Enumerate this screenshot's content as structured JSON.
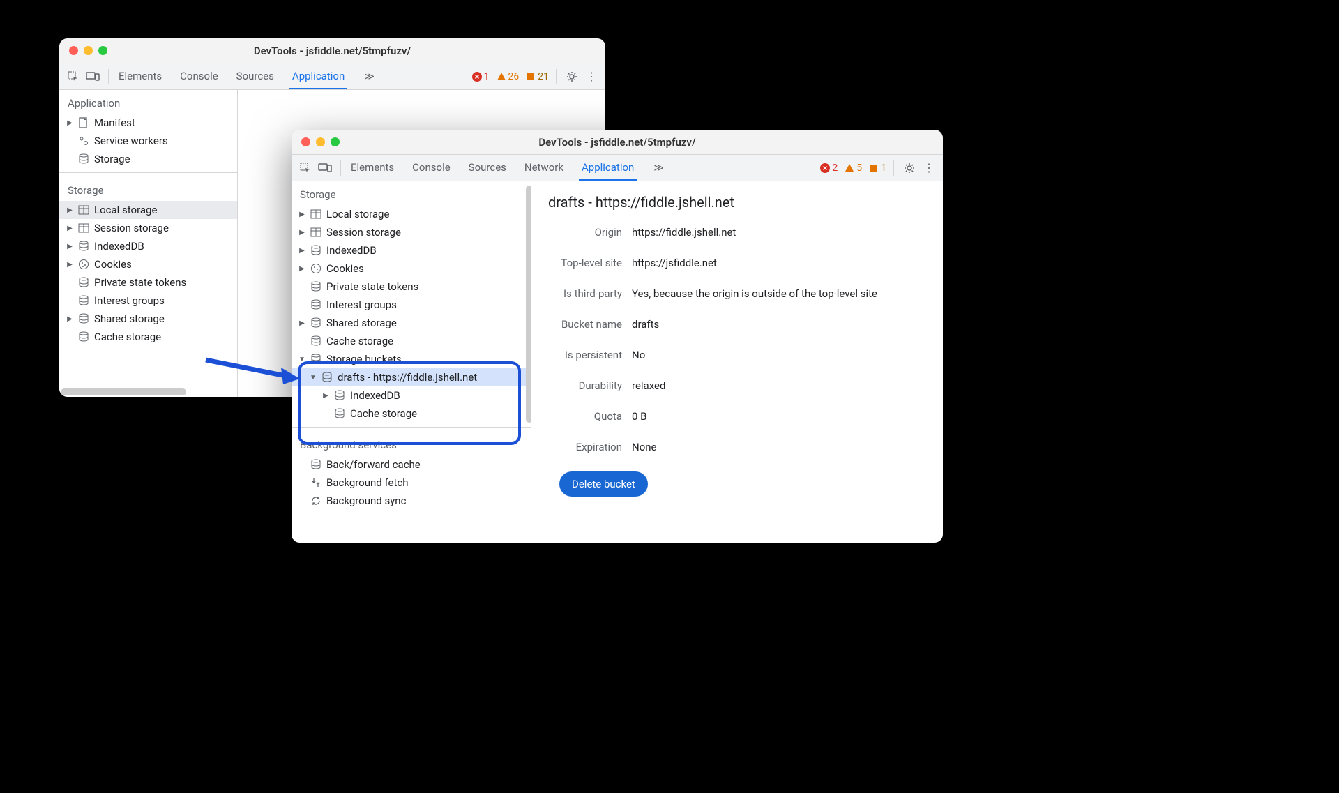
{
  "windowA": {
    "title": "DevTools - jsfiddle.net/5tmpfuzv/",
    "tabs": [
      "Elements",
      "Console",
      "Sources",
      "Application"
    ],
    "active_tab": "Application",
    "badges": {
      "errors": "1",
      "warnings": "26",
      "issues": "21"
    },
    "sections": {
      "application": {
        "heading": "Application",
        "items": [
          "Manifest",
          "Service workers",
          "Storage"
        ]
      },
      "storage": {
        "heading": "Storage",
        "items": [
          "Local storage",
          "Session storage",
          "IndexedDB",
          "Cookies",
          "Private state tokens",
          "Interest groups",
          "Shared storage",
          "Cache storage"
        ]
      }
    }
  },
  "windowB": {
    "title": "DevTools - jsfiddle.net/5tmpfuzv/",
    "tabs": [
      "Elements",
      "Console",
      "Sources",
      "Network",
      "Application"
    ],
    "active_tab": "Application",
    "badges": {
      "errors": "2",
      "warnings": "5",
      "issues": "1"
    },
    "sidebar": {
      "storage_heading": "Storage",
      "storage_items": [
        "Local storage",
        "Session storage",
        "IndexedDB",
        "Cookies",
        "Private state tokens",
        "Interest groups",
        "Shared storage",
        "Cache storage",
        "Storage buckets"
      ],
      "bucket_item": "drafts - https://fiddle.jshell.net",
      "bucket_children": [
        "IndexedDB",
        "Cache storage"
      ],
      "bg_heading": "Background services",
      "bg_items": [
        "Back/forward cache",
        "Background fetch",
        "Background sync"
      ]
    },
    "details": {
      "title": "drafts - https://fiddle.jshell.net",
      "fields": [
        {
          "label": "Origin",
          "value": "https://fiddle.jshell.net"
        },
        {
          "label": "Top-level site",
          "value": "https://jsfiddle.net"
        },
        {
          "label": "Is third-party",
          "value": "Yes, because the origin is outside of the top-level site"
        },
        {
          "label": "Bucket name",
          "value": "drafts"
        },
        {
          "label": "Is persistent",
          "value": "No"
        },
        {
          "label": "Durability",
          "value": "relaxed"
        },
        {
          "label": "Quota",
          "value": "0 B"
        },
        {
          "label": "Expiration",
          "value": "None"
        }
      ],
      "delete_btn": "Delete bucket"
    }
  }
}
